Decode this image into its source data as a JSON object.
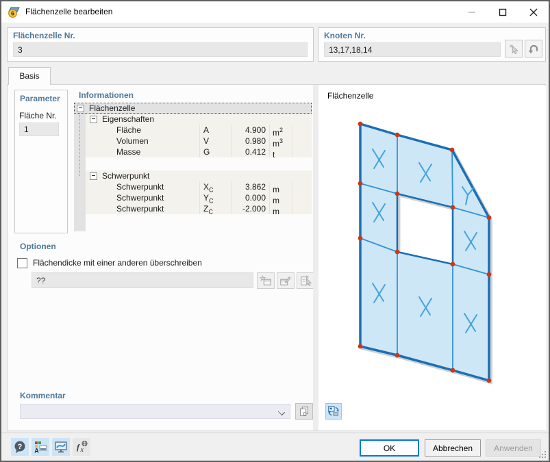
{
  "window": {
    "title": "Flächenzelle bearbeiten",
    "icon_badge": "6"
  },
  "header": {
    "surface_cell_no": {
      "label": "Flächenzelle Nr.",
      "value": "3"
    },
    "node_no": {
      "label": "Knoten Nr.",
      "value": "13,17,18,14"
    }
  },
  "tab": {
    "label": "Basis"
  },
  "parameter": {
    "title": "Parameter",
    "surface_no_label": "Fläche Nr.",
    "surface_no_value": "1"
  },
  "informationen": {
    "title": "Informationen",
    "rows": [
      {
        "label": "Flächenzelle"
      },
      {
        "label": "Eigenschaften"
      },
      {
        "label": "Fläche",
        "symbol": "A",
        "symbol_sub": "",
        "value": "4.900",
        "unit": "m",
        "unit_exp": "2"
      },
      {
        "label": "Volumen",
        "symbol": "V",
        "symbol_sub": "",
        "value": "0.980",
        "unit": "m",
        "unit_exp": "3"
      },
      {
        "label": "Masse",
        "symbol": "G",
        "symbol_sub": "",
        "value": "0.412",
        "unit": "t",
        "unit_exp": ""
      },
      {
        "label": "Schwerpunkt"
      },
      {
        "label": "Schwerpunkt",
        "symbol": "X",
        "symbol_sub": "C",
        "value": "3.862",
        "unit": "m",
        "unit_exp": ""
      },
      {
        "label": "Schwerpunkt",
        "symbol": "Y",
        "symbol_sub": "C",
        "value": "0.000",
        "unit": "m",
        "unit_exp": ""
      },
      {
        "label": "Schwerpunkt",
        "symbol": "Z",
        "symbol_sub": "C",
        "value": "-2.000",
        "unit": "m",
        "unit_exp": ""
      }
    ]
  },
  "optionen": {
    "title": "Optionen",
    "checkbox_label": "Flächendicke mit einer anderen überschreiben",
    "checkbox_checked": false,
    "thickness_value": "??"
  },
  "kommentar": {
    "title": "Kommentar",
    "value": ""
  },
  "preview": {
    "title": "Flächenzelle"
  },
  "footer": {
    "ok": "OK",
    "cancel": "Abbrechen",
    "apply": "Anwenden"
  },
  "colors": {
    "accent": "#0078d7",
    "label_blue": "#4f7899",
    "surface_fill": "#cde7f7",
    "surface_border": "#1b6fb3",
    "mesh_line": "#2f93d6",
    "x_mark": "#45a3da",
    "node_red": "#c8391d"
  }
}
